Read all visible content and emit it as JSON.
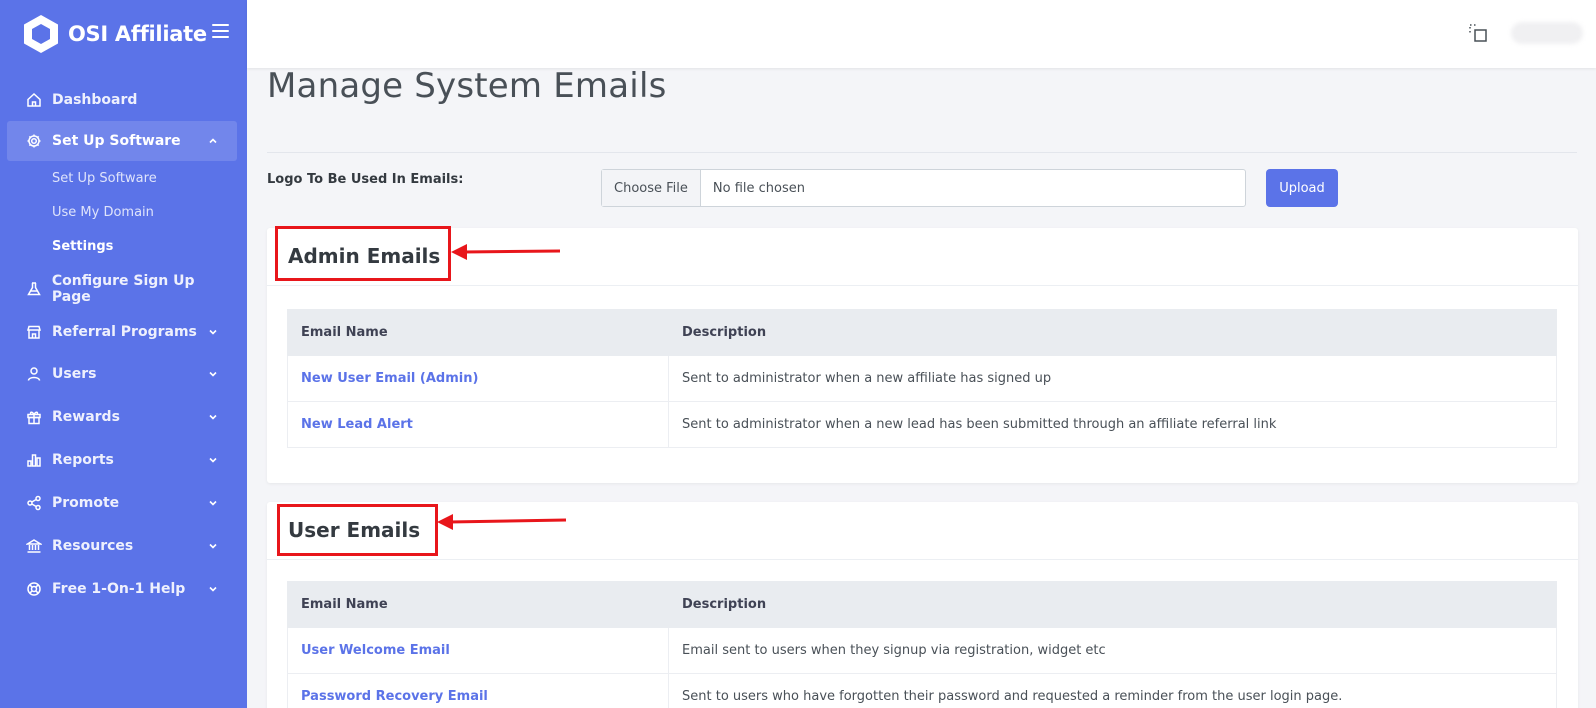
{
  "brand": {
    "name": "OSI Affiliate"
  },
  "sidebar": {
    "items": [
      {
        "label": "Dashboard",
        "icon": "home-icon"
      },
      {
        "label": "Set Up Software",
        "icon": "gear-icon"
      },
      {
        "label": "Configure Sign Up Page",
        "icon": "flask-icon"
      },
      {
        "label": "Referral Programs",
        "icon": "store-icon"
      },
      {
        "label": "Users",
        "icon": "user-icon"
      },
      {
        "label": "Rewards",
        "icon": "gift-icon"
      },
      {
        "label": "Reports",
        "icon": "bar-chart-icon"
      },
      {
        "label": "Promote",
        "icon": "share-icon"
      },
      {
        "label": "Resources",
        "icon": "bank-icon"
      },
      {
        "label": "Free 1-On-1 Help",
        "icon": "lifebuoy-icon"
      }
    ],
    "subitems": [
      {
        "label": "Set Up Software"
      },
      {
        "label": "Use My Domain"
      },
      {
        "label": "Settings"
      }
    ]
  },
  "main": {
    "title": "Manage System Emails",
    "logo_label": "Logo To Be Used In Emails:",
    "file_button": "Choose File",
    "file_name": "No file chosen",
    "upload_label": "Upload"
  },
  "admin_emails": {
    "title": "Admin Emails",
    "columns": [
      "Email Name",
      "Description"
    ],
    "rows": [
      {
        "name": "New User Email (Admin)",
        "description": "Sent to administrator when a new affiliate has signed up"
      },
      {
        "name": "New Lead Alert",
        "description": "Sent to administrator when a new lead has been submitted through an affiliate referral link"
      }
    ]
  },
  "user_emails": {
    "title": "User Emails",
    "columns": [
      "Email Name",
      "Description"
    ],
    "rows": [
      {
        "name": "User Welcome Email",
        "description": "Email sent to users when they signup via registration, widget etc"
      },
      {
        "name": "Password Recovery Email",
        "description": "Sent to users who have forgotten their password and requested a reminder from the user login page."
      }
    ]
  },
  "colors": {
    "accent": "#5b73e8",
    "annotation": "#e8161b"
  }
}
